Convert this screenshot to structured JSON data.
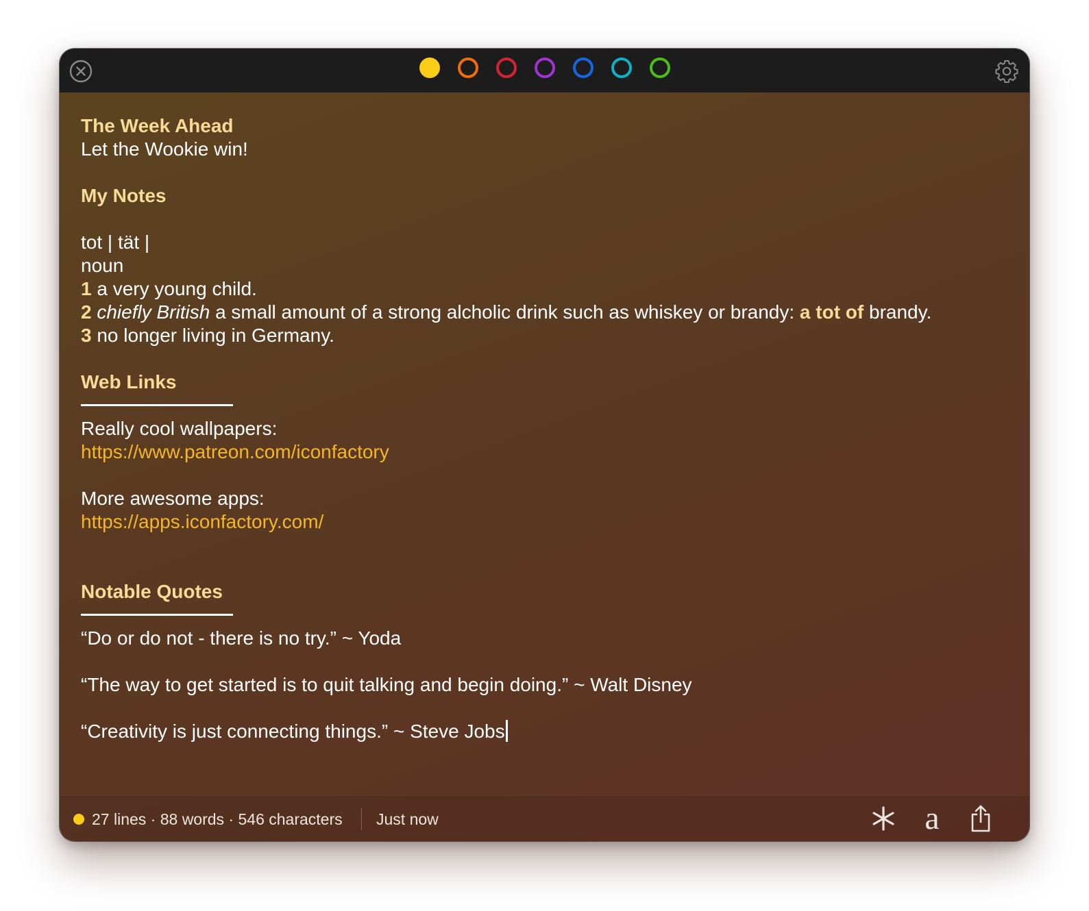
{
  "toolbar": {
    "colors": [
      {
        "name": "yellow",
        "hex": "#f9cd18",
        "selected": true
      },
      {
        "name": "orange",
        "hex": "#ef6c0f",
        "selected": false
      },
      {
        "name": "red",
        "hex": "#d42234",
        "selected": false
      },
      {
        "name": "purple",
        "hex": "#a133d4",
        "selected": false
      },
      {
        "name": "blue",
        "hex": "#1566e0",
        "selected": false
      },
      {
        "name": "teal",
        "hex": "#0db2c6",
        "selected": false
      },
      {
        "name": "green",
        "hex": "#4fbd17",
        "selected": false
      }
    ],
    "close_icon": "close-circle-icon",
    "settings_icon": "gear-icon"
  },
  "note": {
    "week_title": "The Week Ahead",
    "week_text": "Let the Wookie win!",
    "my_notes_title": "My Notes",
    "def_word": "tot | tät |",
    "def_pos": "noun",
    "def1_num": "1",
    "def1_text": " a very young child.",
    "def2_num": "2",
    "def2_em": "chiefly British",
    "def2_text": " a small amount of a strong alcholic drink such as whiskey or brandy: ",
    "def2_hl": "a tot of",
    "def2_end": " brandy.",
    "def3_num": "3",
    "def3_text": " no longer living in Germany.",
    "links_title": "Web Links",
    "link1_label": "Really cool wallpapers:",
    "link1_url": "https://www.patreon.com/iconfactory",
    "link2_label": "More awesome apps:",
    "link2_url": "https://apps.iconfactory.com/",
    "quotes_title": "Notable Quotes",
    "quote1": "“Do or do not - there is no try.” ~ Yoda",
    "quote2": "“The way to get started is to quit talking and begin doing.” ~ Walt Disney",
    "quote3": "“Creativity is just connecting things.” ~ Steve Jobs"
  },
  "status": {
    "dot_color": "#f9cd18",
    "stats": "27 lines · 88 words · 546 characters",
    "updated": "Just now",
    "asterisk_icon": "asterisk-icon",
    "font_icon": "font-icon",
    "font_glyph": "a",
    "share_icon": "share-icon"
  }
}
